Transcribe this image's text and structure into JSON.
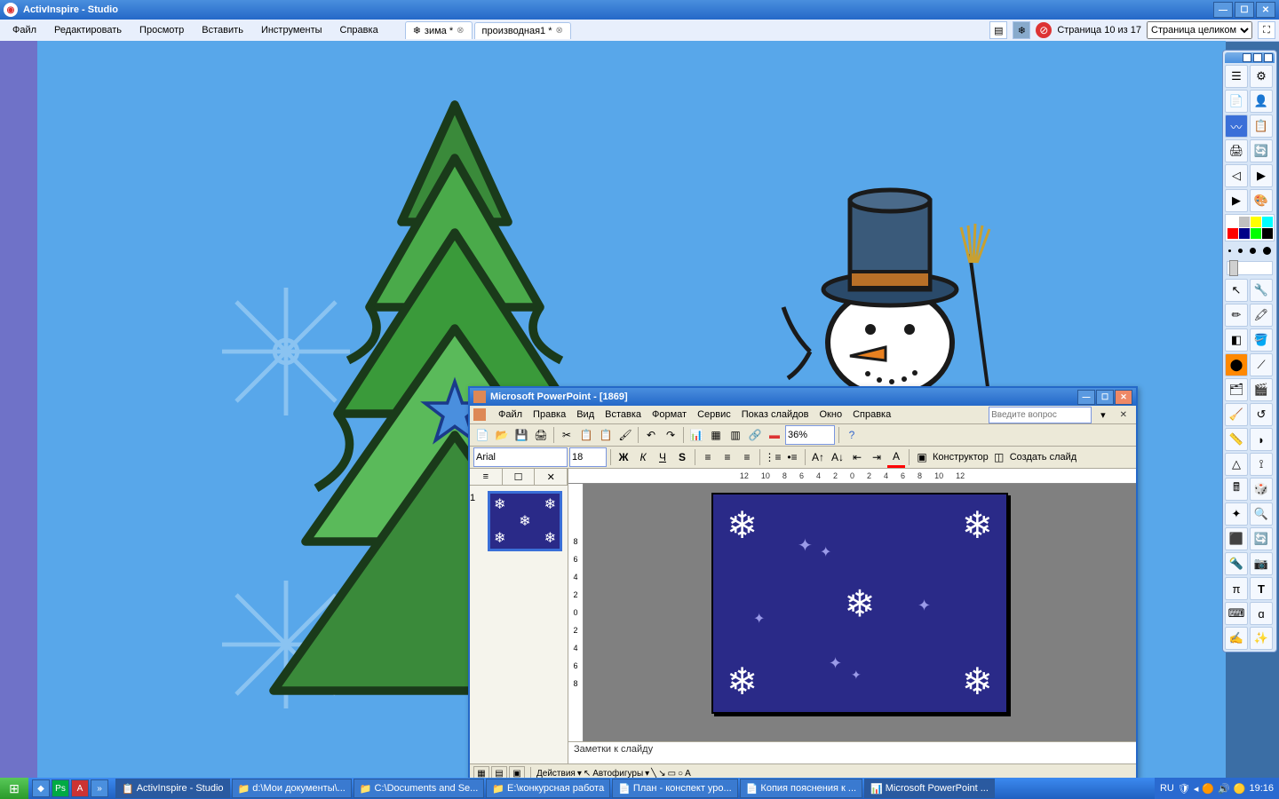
{
  "titlebar": {
    "title": "ActivInspire - Studio"
  },
  "menu": {
    "file": "Файл",
    "edit": "Редактировать",
    "view": "Просмотр",
    "insert": "Вставить",
    "tools": "Инструменты",
    "help": "Справка"
  },
  "tabs": [
    {
      "icon": "❄",
      "label": "зима *"
    },
    {
      "label": "производная1 *"
    }
  ],
  "pageinfo": "Страница 10 из 17",
  "zoom_options": [
    "Страница целиком"
  ],
  "toolbox_colors": [
    "#ffffff",
    "#c0c0c0",
    "#ffff00",
    "#00ffff",
    "#ff0000",
    "#000080",
    "#00ff00",
    "#000000"
  ],
  "ppw": {
    "title": "Microsoft PowerPoint - [1869]",
    "menu": {
      "file": "Файл",
      "edit": "Правка",
      "view": "Вид",
      "insert": "Вставка",
      "format": "Формат",
      "service": "Сервис",
      "slideshow": "Показ слайдов",
      "window": "Окно",
      "help": "Справка"
    },
    "help_placeholder": "Введите вопрос",
    "font": "Arial",
    "fontsize": "18",
    "zoom": "36%",
    "construct": "Конструктор",
    "newslide": "Создать слайд",
    "ruler_h": [
      "12",
      "10",
      "8",
      "6",
      "4",
      "2",
      "0",
      "2",
      "4",
      "6",
      "8",
      "10",
      "12"
    ],
    "ruler_v": [
      "8",
      "6",
      "4",
      "2",
      "0",
      "2",
      "4",
      "6",
      "8"
    ],
    "slide_num": "1",
    "notes": "Заметки к слайду",
    "actions": "Действия",
    "autoshapes": "Автофигуры"
  },
  "taskbar": {
    "tasks": [
      {
        "icon": "📋",
        "label": "ActivInspire - Studio"
      },
      {
        "icon": "📁",
        "label": "d:\\Мои документы\\..."
      },
      {
        "icon": "📁",
        "label": "C:\\Documents and Se..."
      },
      {
        "icon": "📁",
        "label": "E:\\конкурсная работа"
      },
      {
        "icon": "📄",
        "label": "План - конспект уро..."
      },
      {
        "icon": "📄",
        "label": "Копия пояснения к ..."
      },
      {
        "icon": "📊",
        "label": "Microsoft PowerPoint ..."
      }
    ],
    "lang": "RU",
    "time": "19:16"
  }
}
